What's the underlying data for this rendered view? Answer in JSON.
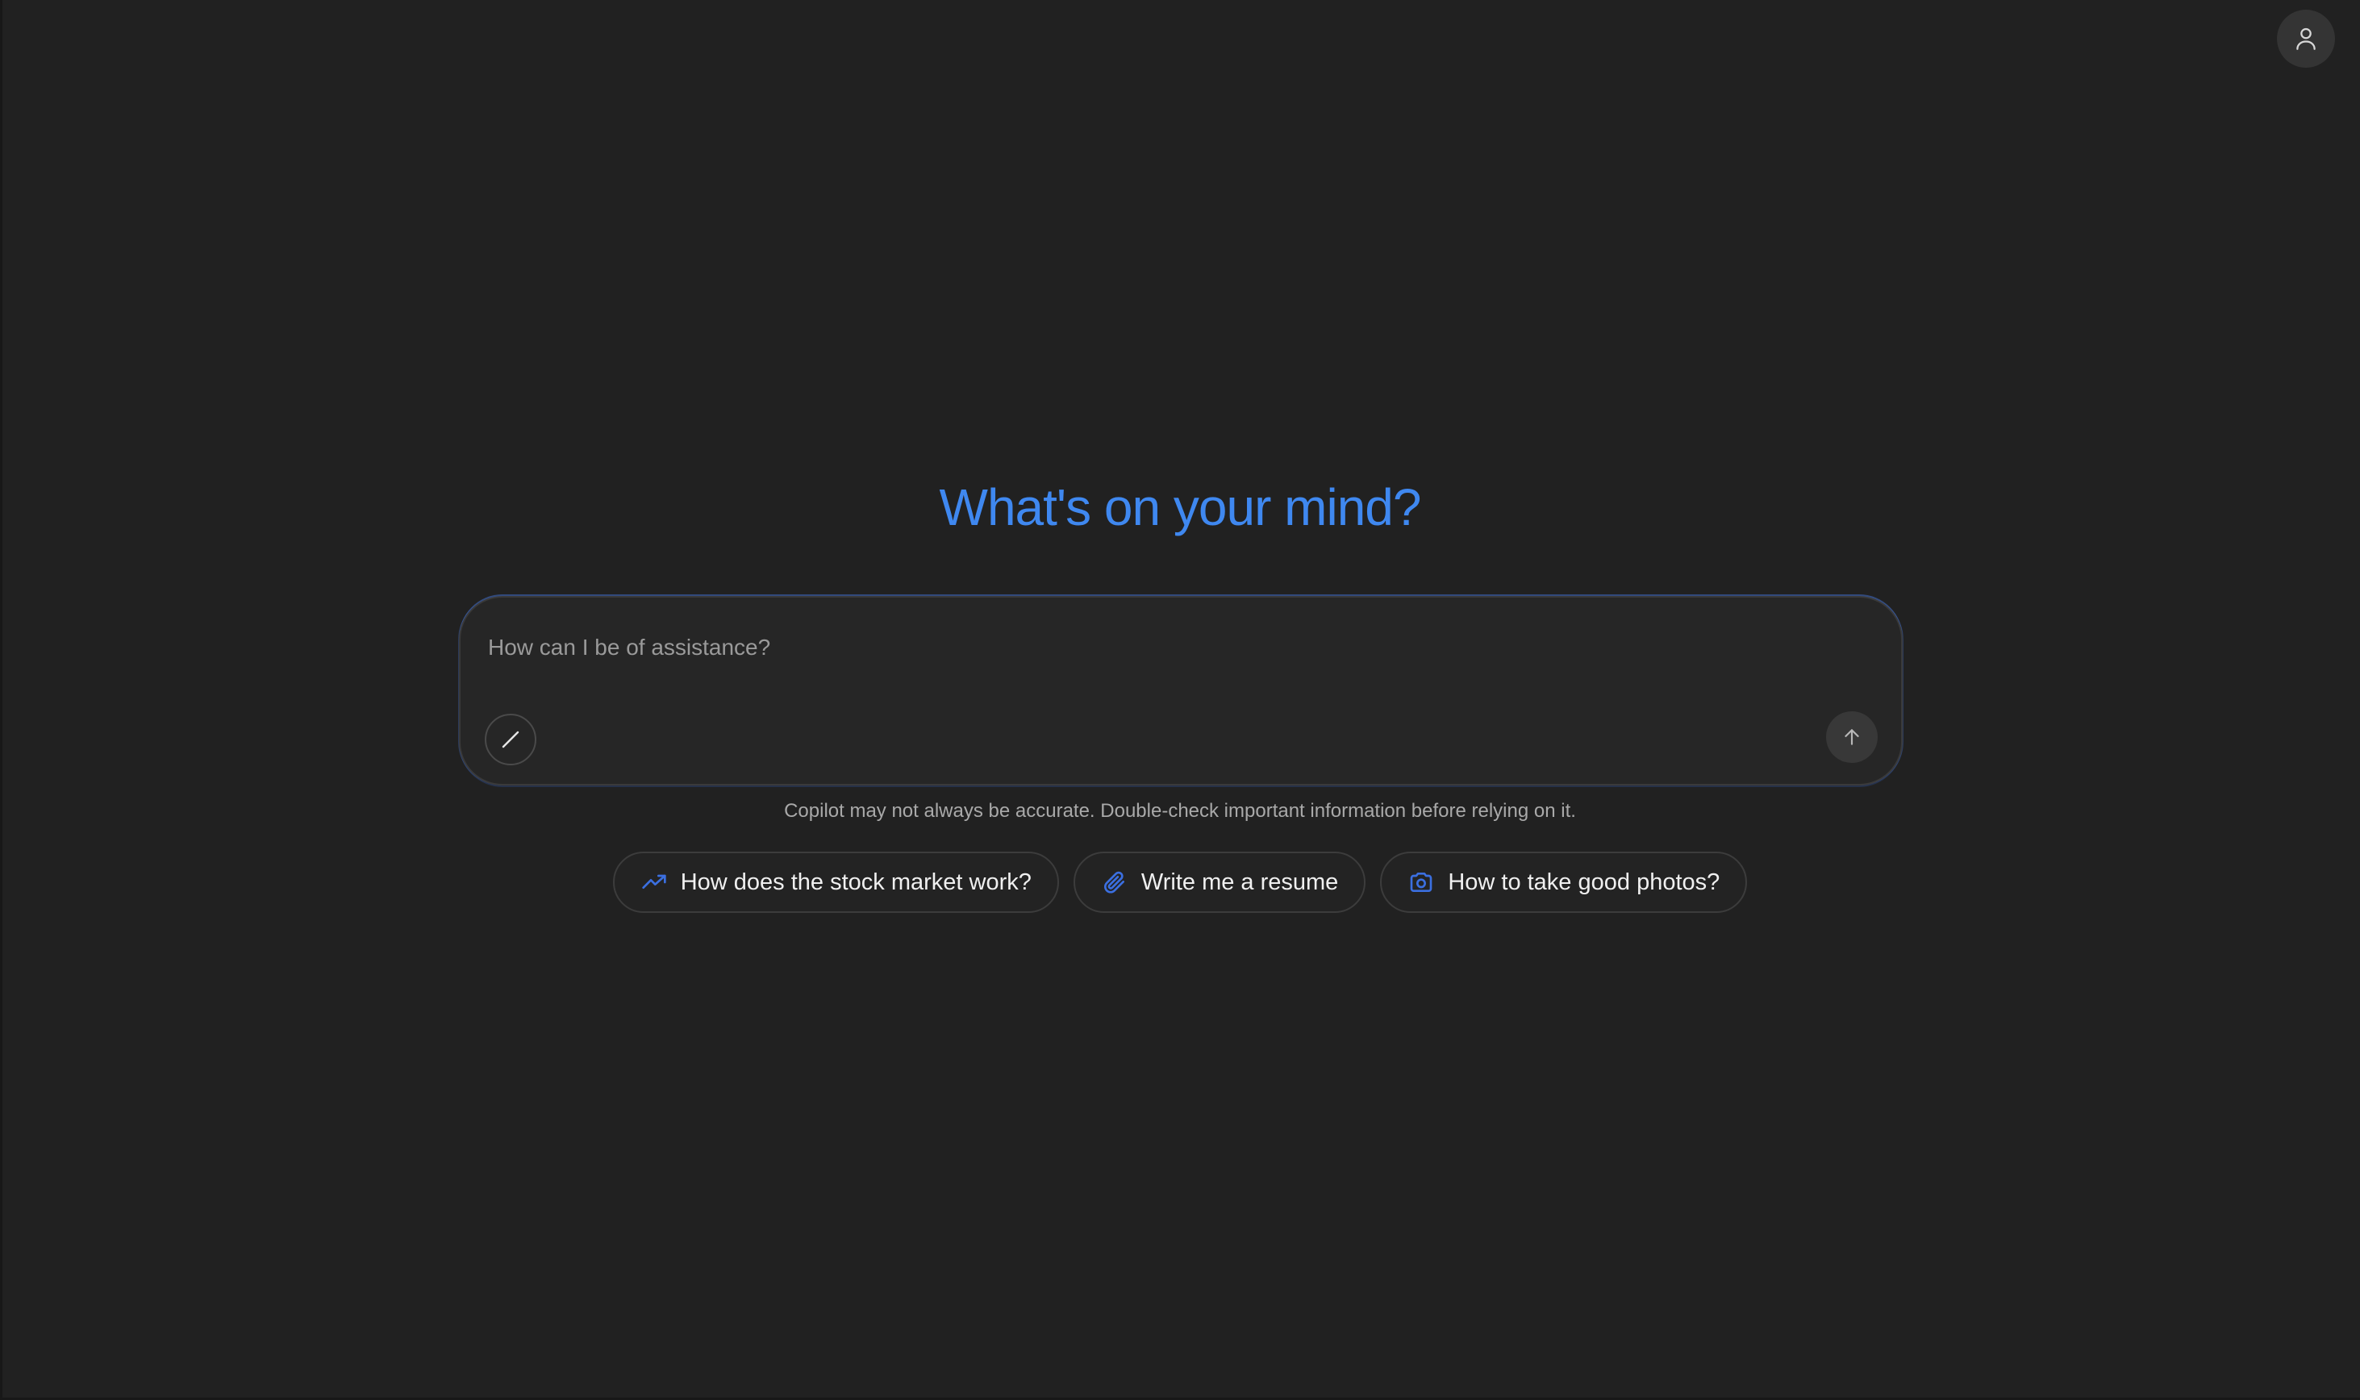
{
  "header": {
    "profile_icon": "person-icon"
  },
  "main": {
    "headline": "What's on your mind?",
    "composer": {
      "placeholder": "How can I be of assistance?",
      "value": "",
      "left_icon": "slash-icon",
      "send_icon": "arrow-up-icon"
    },
    "disclaimer": "Copilot may not always be accurate. Double-check important information before relying on it.",
    "suggestions": [
      {
        "label": "How does the stock market work?",
        "icon": "trending-up-icon"
      },
      {
        "label": "Write me a resume",
        "icon": "paperclip-icon"
      },
      {
        "label": "How to take good photos?",
        "icon": "camera-icon"
      }
    ]
  },
  "colors": {
    "background": "#212121",
    "accent": "#3f88f0",
    "icon_accent": "#3b6fe0"
  }
}
